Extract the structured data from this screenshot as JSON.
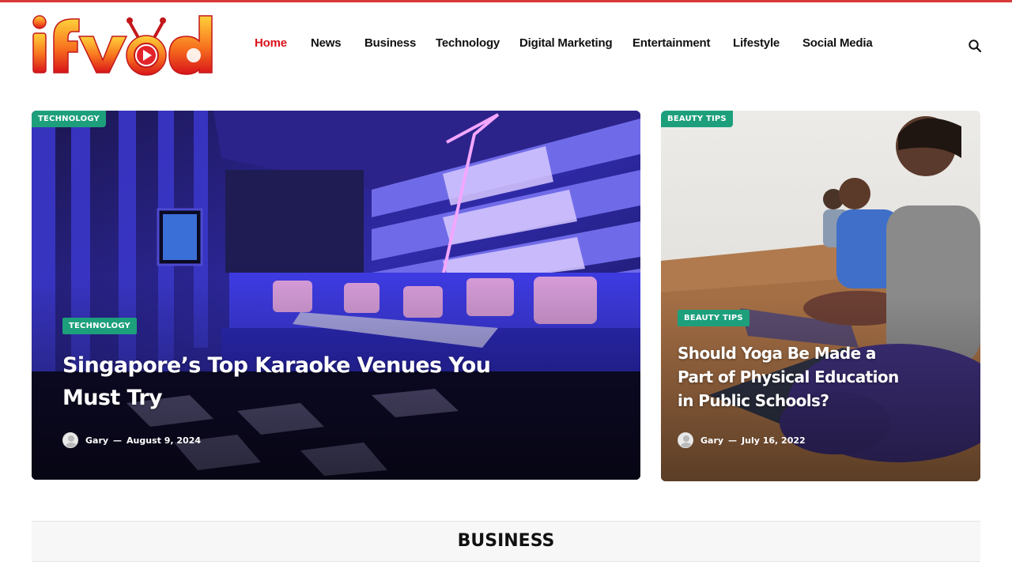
{
  "site": {
    "logo_text": "ifvod",
    "accent_color": "#d9141b",
    "badge_color": "#1d9f7c"
  },
  "nav": {
    "items": [
      {
        "label": "Home",
        "active": true
      },
      {
        "label": "News"
      },
      {
        "label": "Business"
      },
      {
        "label": "Technology"
      },
      {
        "label": "Digital Marketing"
      },
      {
        "label": "Entertainment"
      },
      {
        "label": "Lifestyle"
      },
      {
        "label": "Social Media"
      }
    ],
    "search_icon": "search-icon"
  },
  "featured": [
    {
      "category_top": "TECHNOLOGY",
      "category": "TECHNOLOGY",
      "title": "Singapore’s Top Karaoke Venues You Must Try",
      "author": "Gary",
      "date": "August 9, 2024"
    },
    {
      "category_top": "BEAUTY TIPS",
      "category": "BEAUTY TIPS",
      "title": "Should Yoga Be Made a Part of Physical Education in Public Schools?",
      "author": "Gary",
      "date": "July 16, 2022"
    }
  ],
  "sections": {
    "business_heading": "BUSINESS"
  }
}
